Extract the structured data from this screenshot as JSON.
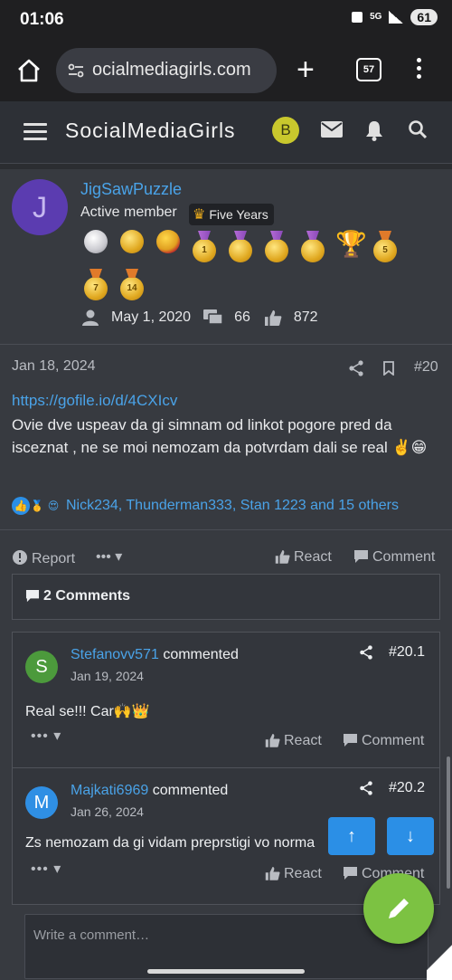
{
  "status": {
    "time": "01:06",
    "network": "5G",
    "battery": "61"
  },
  "browser": {
    "url": "ocialmediagirls.com",
    "tab_count": "57",
    "new_tab": "+"
  },
  "header": {
    "site_title": "SocialMediaGirls",
    "user_initial": "B"
  },
  "member": {
    "initial": "J",
    "name": "JigSawPuzzle",
    "title": "Active member",
    "badge": "Five Years",
    "trophies": [
      "",
      "",
      "",
      "1",
      "",
      "",
      "",
      "",
      "5",
      "7",
      "14"
    ],
    "joined": "May 1, 2020",
    "messages": "66",
    "reactions": "872"
  },
  "post": {
    "date": "Jan 18, 2024",
    "number": "#20",
    "link": "https://gofile.io/d/4CXIcv",
    "text": "Ovie dve uspeav da gi simnam od linkot pogore pred da isceznat , ne se moi nemozam da potvrdam dali se real ✌️😁",
    "reactions_summary": "Nick234, Thunderman333, Stan 1223 and 15 others",
    "actions": {
      "report": "Report",
      "more": "•••",
      "react": "React",
      "comment": "Comment"
    }
  },
  "comments_header": "2 Comments",
  "comments": [
    {
      "initial": "S",
      "avatar_color": "#4c9a3c",
      "name": "Stefanovv571",
      "verb": "commented",
      "date": "Jan 19, 2024",
      "number": "#20.1",
      "text": "Real se!!! Car🙌👑",
      "more": "•••",
      "react": "React",
      "comment": "Comment"
    },
    {
      "initial": "M",
      "avatar_color": "#2f8fe4",
      "name": "Majkati6969",
      "verb": "commented",
      "date": "Jan 26, 2024",
      "number": "#20.2",
      "text": "Zs nemozam da gi vidam preprstigi vo norma",
      "more": "•••",
      "react": "React",
      "comment": "Comment"
    }
  ],
  "write_placeholder": "Write a comment…",
  "colors": {
    "accent": "#4aa3e8",
    "fab": "#7cc242",
    "scroll_btn": "#2b8fe6"
  }
}
